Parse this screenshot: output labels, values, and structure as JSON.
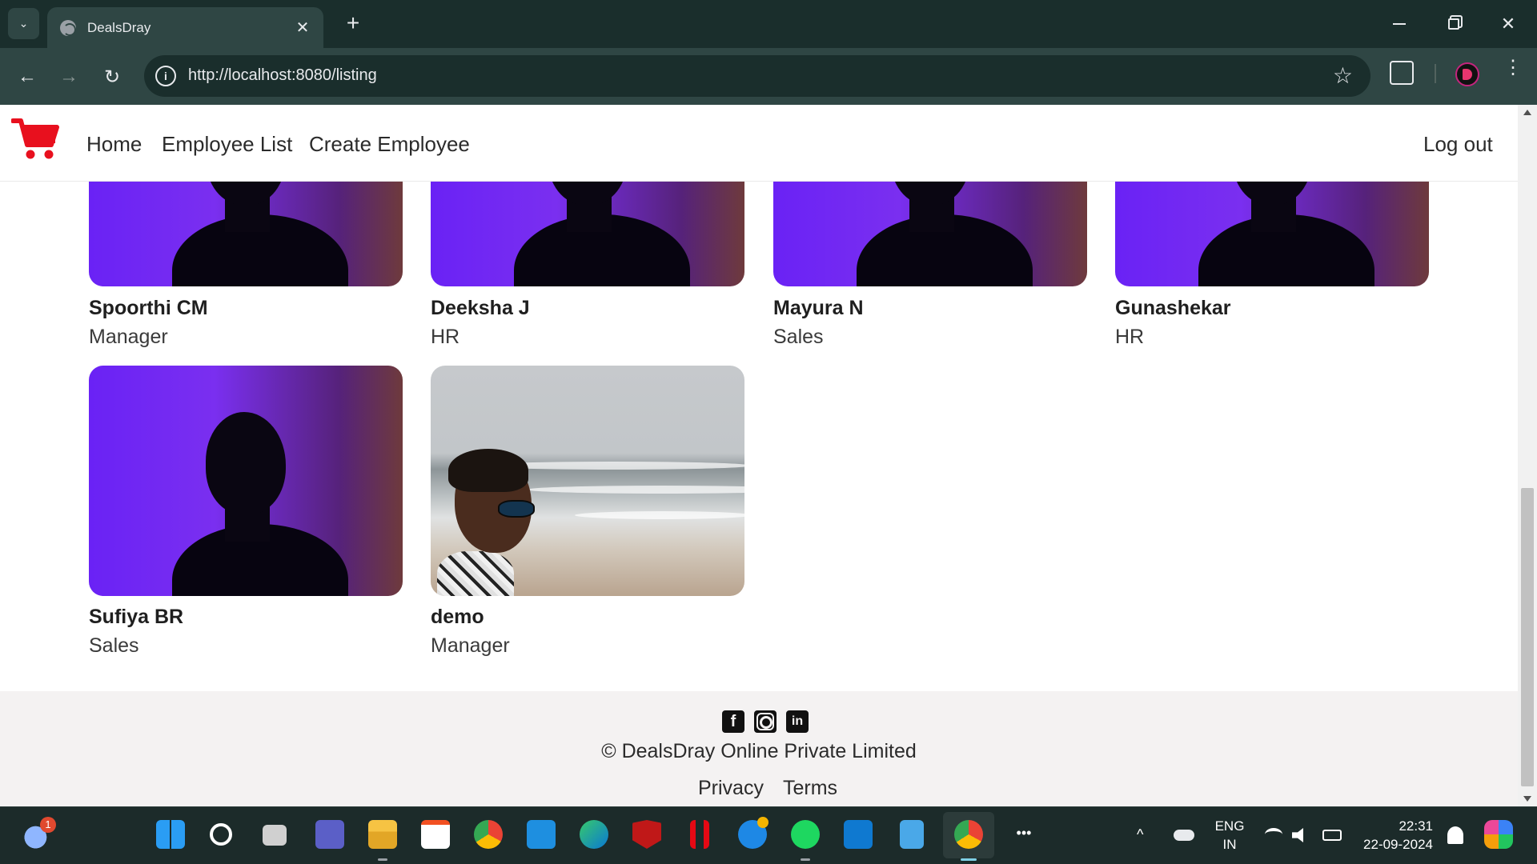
{
  "browser": {
    "tab_title": "DealsDray",
    "tab_close": "✕",
    "new_tab": "+",
    "url": "http://localhost:8080/listing",
    "back": "←",
    "forward": "→",
    "reload": "↻",
    "star": "☆",
    "info": "i",
    "menu": "⋮",
    "close_window": "✕"
  },
  "site_nav": {
    "brand_color": "#e8101e",
    "links": [
      "Home",
      "Employee List",
      "Create Employee"
    ],
    "logout": "Log out"
  },
  "employees": [
    {
      "name": "Spoorthi CM",
      "role": "Manager",
      "photo": "purple-silhouette"
    },
    {
      "name": "Deeksha J",
      "role": "HR",
      "photo": "purple-silhouette"
    },
    {
      "name": "Mayura N",
      "role": "Sales",
      "photo": "purple-silhouette"
    },
    {
      "name": "Gunashekar",
      "role": "HR",
      "photo": "purple-silhouette"
    },
    {
      "name": "Sufiya BR",
      "role": "Sales",
      "photo": "purple-silhouette"
    },
    {
      "name": "demo",
      "role": "Manager",
      "photo": "beach-portrait"
    }
  ],
  "footer": {
    "social_icons": [
      "facebook-icon",
      "instagram-icon",
      "linkedin-icon"
    ],
    "facebook_glyph": "f",
    "linkedin_glyph": "in",
    "copyright": "© DealsDray Online Private Limited",
    "links": [
      "Privacy",
      "Terms"
    ]
  },
  "taskbar": {
    "weather_badge": "1",
    "apps": [
      "windows-start",
      "search",
      "task-view",
      "teams",
      "file-explorer",
      "microsoft-store",
      "chrome",
      "myhp",
      "edge",
      "mcafee",
      "netflix",
      "get-help",
      "spotify",
      "prime-video",
      "notepad",
      "chrome-active",
      "more"
    ],
    "more": "•••",
    "chevron": "^",
    "lang_top": "ENG",
    "lang_bottom": "IN",
    "time": "22:31",
    "date": "22-09-2024"
  }
}
